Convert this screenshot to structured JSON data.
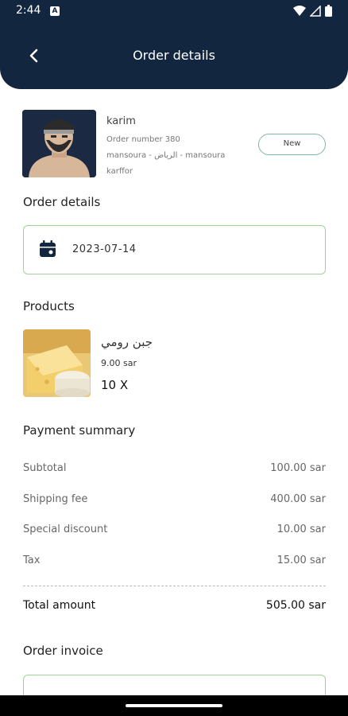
{
  "status_bar": {
    "time": "2:44",
    "notification_letter": "A"
  },
  "header": {
    "title": "Order details",
    "back_icon": "chevron-left-icon"
  },
  "customer": {
    "name": "karim",
    "order_number": "Order number 380",
    "address": "mansoura - الرياض - mansoura",
    "branch": "karffor",
    "status": "New"
  },
  "order_details": {
    "title": "Order details",
    "date": "2023-07-14",
    "icon": "calendar-icon"
  },
  "products": {
    "title": "Products",
    "items": [
      {
        "name": "جبن رومي",
        "price": "9.00 sar",
        "quantity": "10 X"
      }
    ]
  },
  "payment": {
    "title": "Payment summary",
    "rows": [
      {
        "label": "Subtotal",
        "value": "100.00 sar"
      },
      {
        "label": "Shipping fee",
        "value": "400.00 sar"
      },
      {
        "label": "Special discount",
        "value": "10.00 sar"
      },
      {
        "label": "Tax",
        "value": "15.00 sar"
      }
    ],
    "total_label": "Total amount",
    "total_value": "505.00 sar"
  },
  "invoice": {
    "title": "Order invoice"
  },
  "colors": {
    "header_bg": "#13263f",
    "accent_border": "#9fd39a",
    "status_border": "#7fb6b0"
  }
}
